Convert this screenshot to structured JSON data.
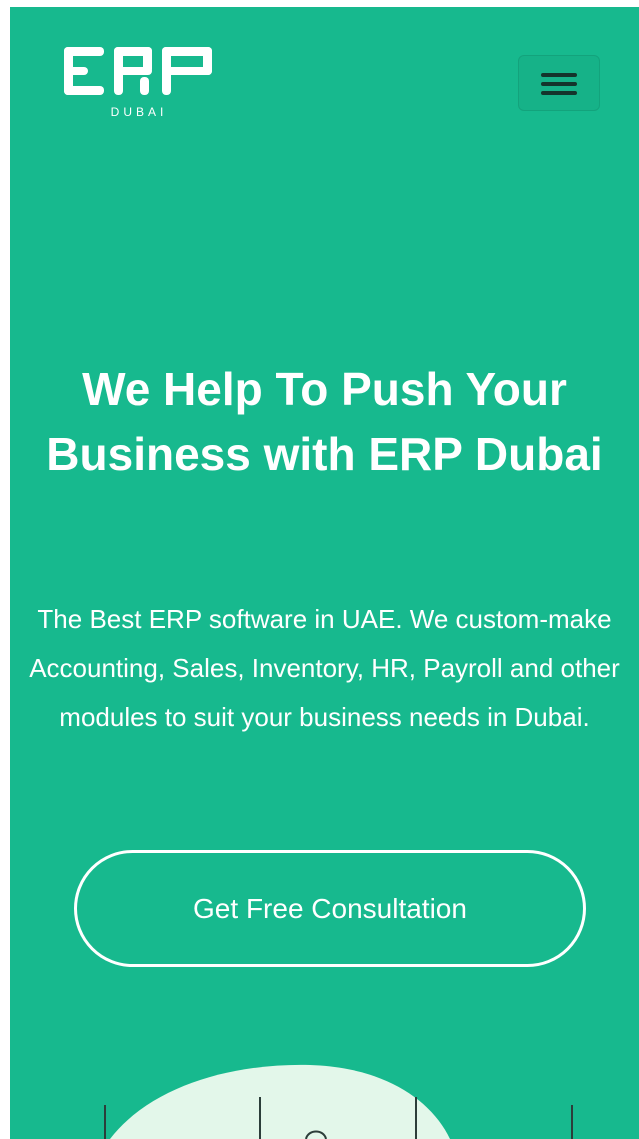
{
  "header": {
    "logo_text": "ERP",
    "logo_subtext": "DUBAI",
    "menu_icon": "hamburger-menu-icon"
  },
  "hero": {
    "title": "We Help To Push Your Business with ERP Dubai",
    "description": "The Best ERP software in UAE. We custom-make Accounting, Sales, Inventory, HR, Payroll and other modules to suit your business needs in Dubai.",
    "cta_label": "Get Free Consultation"
  },
  "colors": {
    "background": "#17b98e",
    "text": "#ffffff",
    "menu_icon": "#14352c",
    "illustration_blob": "#e3f7ea"
  }
}
